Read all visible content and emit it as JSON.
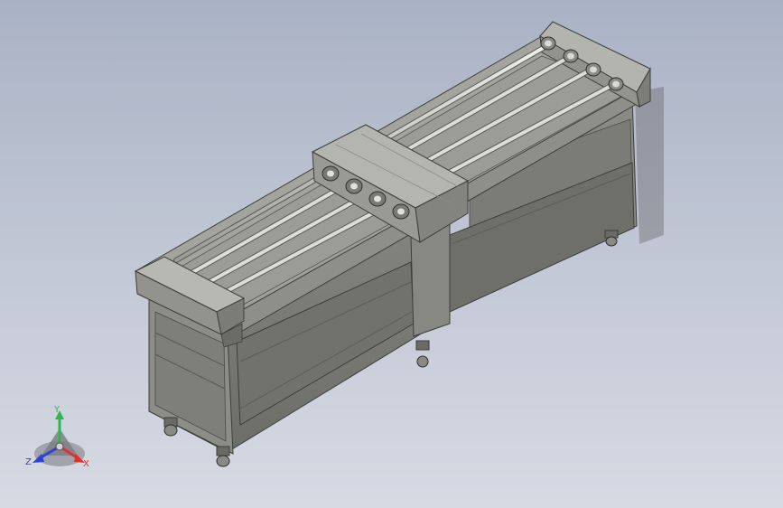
{
  "triad": {
    "x_label": "X",
    "y_label": "Y",
    "z_label": "Z",
    "colors": {
      "x": "#e03030",
      "y": "#2fb84a",
      "z": "#2d43d8"
    }
  },
  "model": {
    "rod_count": 4,
    "colors": {
      "body": "#8c8c86",
      "panel": "#7b7b76",
      "edge": "#3d3d3a",
      "light": "#b6b6b0",
      "rod": "#d4d4d0"
    }
  }
}
